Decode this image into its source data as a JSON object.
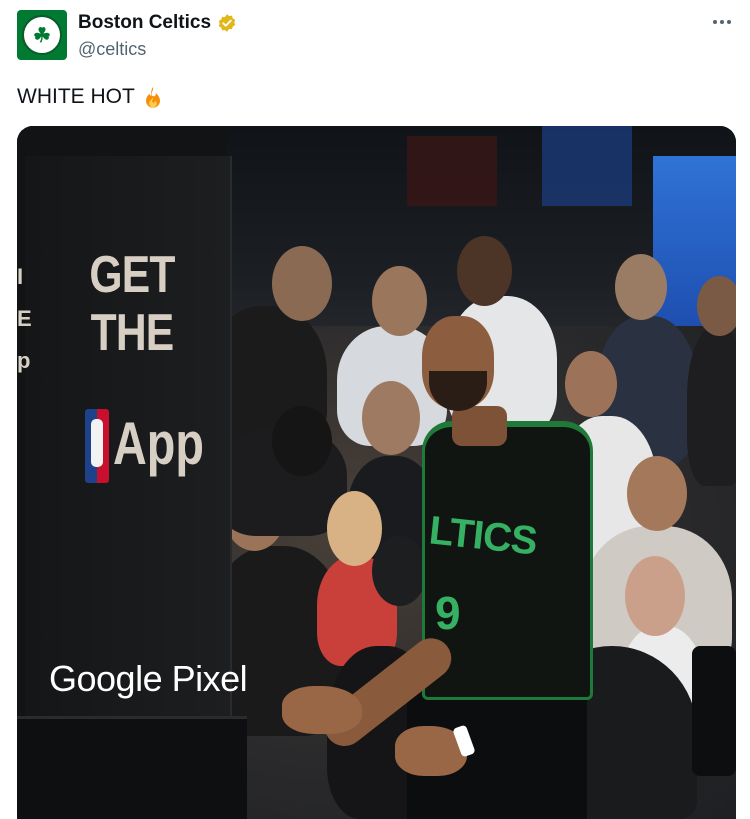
{
  "header": {
    "display_name": "Boston Celtics",
    "handle": "@celtics",
    "avatar_letter": "☘",
    "verified_color": "#e2b719",
    "brand_color": "#007a33"
  },
  "tweet": {
    "text": "WHITE HOT",
    "emoji": "fire-icon"
  },
  "media": {
    "stanchion_text_1": "GET",
    "stanchion_text_2": "THE",
    "app_text": "App",
    "sponsor_text": "Google Pixel",
    "side_letters": "I\nE\np",
    "jersey_text": "LTICS",
    "jersey_number": "9"
  }
}
